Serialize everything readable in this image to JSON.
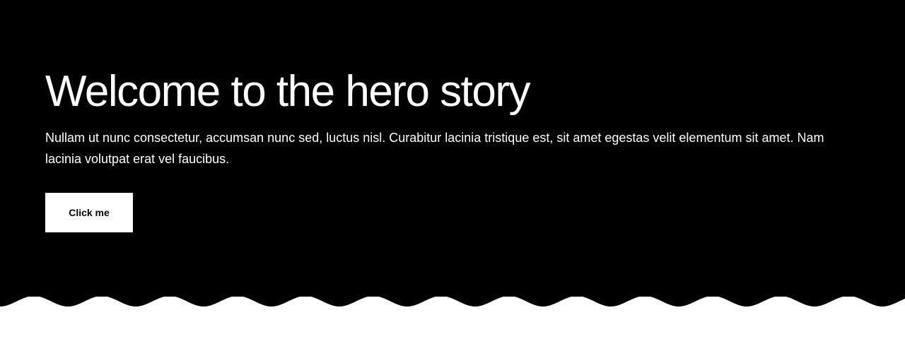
{
  "hero": {
    "title": "Welcome to the hero story",
    "text": "Nullam ut nunc consectetur, accumsan nunc sed, luctus nisl. Curabitur lacinia tristique est, sit amet egestas velit elementum sit amet. Nam lacinia volutpat erat vel faucibus.",
    "button_label": "Click me"
  },
  "colors": {
    "hero_background": "#000000",
    "hero_text": "#ffffff",
    "button_background": "#ffffff",
    "button_text": "#000000",
    "page_background": "#ffffff"
  }
}
